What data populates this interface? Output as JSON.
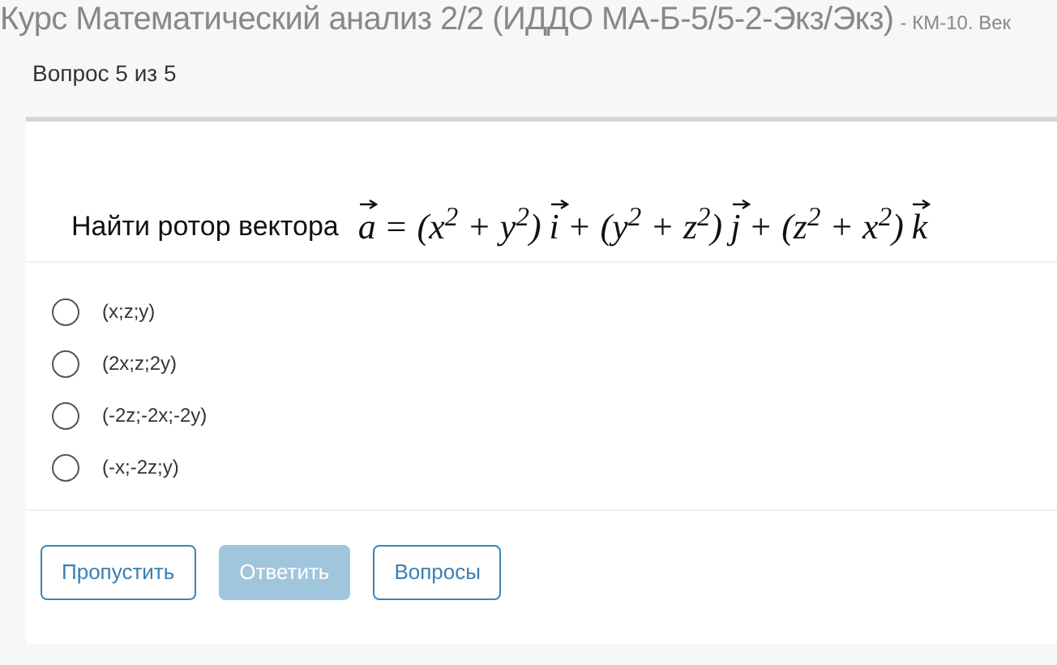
{
  "header": {
    "course": "Курс Математический анализ 2/2 (ИДДО МА-Б-5/5-2-Экз/Экз)",
    "suffix": "- КМ-10. Век"
  },
  "progress": "Вопрос 5 из 5",
  "question": {
    "text": "Найти ротор вектора",
    "formula": [
      {
        "kind": "vector",
        "text": "a"
      },
      {
        "kind": "text",
        "text": "= (x$^{2}$ + y$^{2}$)"
      },
      {
        "kind": "vector",
        "text": "i"
      },
      {
        "kind": "text",
        "text": "+ (y$^{2}$ + z$^{2}$)"
      },
      {
        "kind": "vector",
        "text": "j"
      },
      {
        "kind": "text",
        "text": "+ (z$^{2}$ + x$^{2}$)"
      },
      {
        "kind": "vector",
        "text": "k"
      }
    ]
  },
  "options": [
    {
      "label": "(x;z;y)",
      "selected": false
    },
    {
      "label": "(2x;z;2y)",
      "selected": false
    },
    {
      "label": "(-2z;-2x;-2y)",
      "selected": false
    },
    {
      "label": "(-x;-2z;y)",
      "selected": false
    }
  ],
  "buttons": [
    {
      "label": "Пропустить",
      "disabled": false
    },
    {
      "label": "Ответить",
      "disabled": true
    },
    {
      "label": "Вопросы",
      "disabled": false
    }
  ]
}
